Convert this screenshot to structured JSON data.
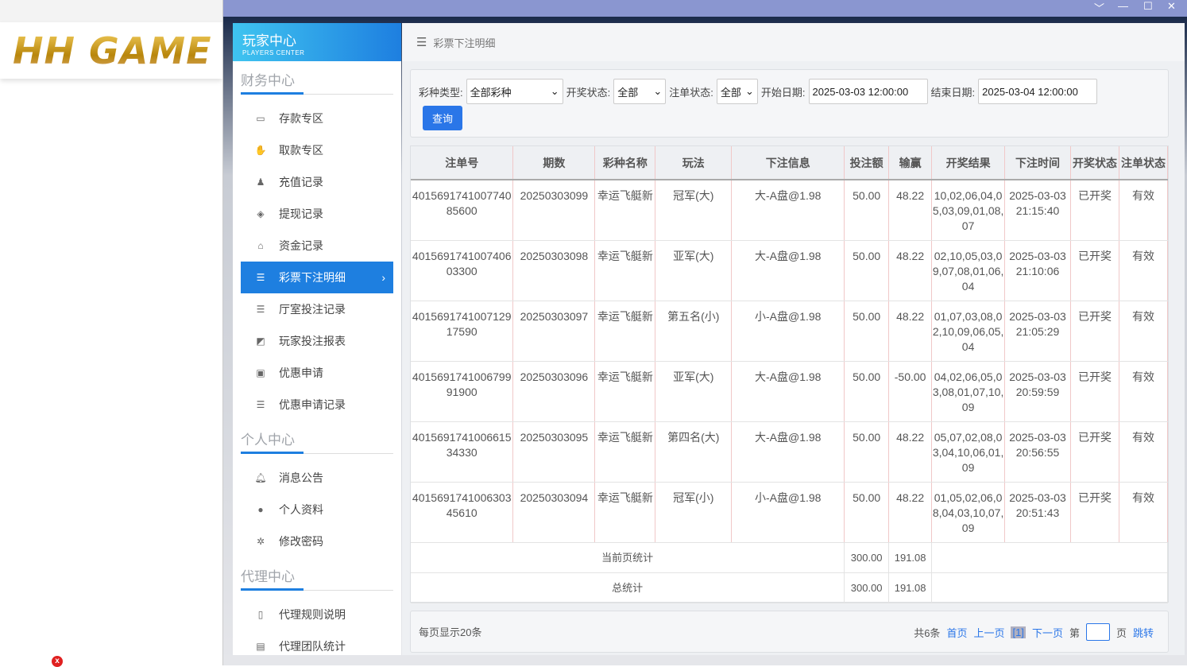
{
  "logo": {
    "text": "HH GAME"
  },
  "window": {
    "controls": [
      "chevron-down",
      "minimize",
      "maximize",
      "close"
    ]
  },
  "sidebar": {
    "title": "玩家中心",
    "subtitle": "PLAYERS CENTER",
    "sections": [
      {
        "title": "财务中心",
        "items": [
          {
            "label": "存款专区",
            "icon": "card-icon"
          },
          {
            "label": "取款专区",
            "icon": "hand-money-icon"
          },
          {
            "label": "充值记录",
            "icon": "money-bag-icon"
          },
          {
            "label": "提现记录",
            "icon": "wallet-icon"
          },
          {
            "label": "资金记录",
            "icon": "bank-icon"
          },
          {
            "label": "彩票下注明细",
            "icon": "list-icon",
            "active": true
          },
          {
            "label": "厅室投注记录",
            "icon": "list-icon"
          },
          {
            "label": "玩家投注报表",
            "icon": "chart-icon"
          },
          {
            "label": "优惠申请",
            "icon": "gift-icon"
          },
          {
            "label": "优惠申请记录",
            "icon": "list-icon"
          }
        ]
      },
      {
        "title": "个人中心",
        "items": [
          {
            "label": "消息公告",
            "icon": "bell-icon"
          },
          {
            "label": "个人资料",
            "icon": "user-icon"
          },
          {
            "label": "修改密码",
            "icon": "gear-icon"
          }
        ]
      },
      {
        "title": "代理中心",
        "items": [
          {
            "label": "代理规则说明",
            "icon": "document-icon"
          },
          {
            "label": "代理团队统计",
            "icon": "report-icon"
          }
        ]
      }
    ]
  },
  "breadcrumb": "彩票下注明细",
  "filter": {
    "type_label": "彩种类型:",
    "type_value": "全部彩种",
    "draw_label": "开奖状态:",
    "draw_value": "全部",
    "order_label": "注单状态:",
    "order_value": "全部",
    "start_label": "开始日期:",
    "start_value": "2025-03-03 12:00:00",
    "end_label": "结束日期:",
    "end_value": "2025-03-04 12:00:00",
    "query": "查询"
  },
  "table": {
    "headers": [
      "注单号",
      "期数",
      "彩种名称",
      "玩法",
      "下注信息",
      "投注额",
      "输赢",
      "开奖结果",
      "下注时间",
      "开奖状态",
      "注单状态"
    ],
    "rows": [
      [
        "401569174100774085600",
        "20250303099",
        "幸运飞艇新",
        "冠军(大)",
        "大-A盘@1.98",
        "50.00",
        "48.22",
        "10,02,06,04,05,03,09,01,08,07",
        "2025-03-03 21:15:40",
        "已开奖",
        "有效"
      ],
      [
        "401569174100740603300",
        "20250303098",
        "幸运飞艇新",
        "亚军(大)",
        "大-A盘@1.98",
        "50.00",
        "48.22",
        "02,10,05,03,09,07,08,01,06,04",
        "2025-03-03 21:10:06",
        "已开奖",
        "有效"
      ],
      [
        "401569174100712917590",
        "20250303097",
        "幸运飞艇新",
        "第五名(小)",
        "小-A盘@1.98",
        "50.00",
        "48.22",
        "01,07,03,08,02,10,09,06,05,04",
        "2025-03-03 21:05:29",
        "已开奖",
        "有效"
      ],
      [
        "401569174100679991900",
        "20250303096",
        "幸运飞艇新",
        "亚军(大)",
        "大-A盘@1.98",
        "50.00",
        "-50.00",
        "04,02,06,05,03,08,01,07,10,09",
        "2025-03-03 20:59:59",
        "已开奖",
        "有效"
      ],
      [
        "401569174100661534330",
        "20250303095",
        "幸运飞艇新",
        "第四名(大)",
        "大-A盘@1.98",
        "50.00",
        "48.22",
        "05,07,02,08,03,04,10,06,01,09",
        "2025-03-03 20:56:55",
        "已开奖",
        "有效"
      ],
      [
        "401569174100630345610",
        "20250303094",
        "幸运飞艇新",
        "冠军(小)",
        "小-A盘@1.98",
        "50.00",
        "48.22",
        "01,05,02,06,08,04,03,10,07,09",
        "2025-03-03 20:51:43",
        "已开奖",
        "有效"
      ]
    ],
    "page_sum": {
      "label": "当前页统计",
      "bet": "300.00",
      "win": "191.08"
    },
    "total_sum": {
      "label": "总统计",
      "bet": "300.00",
      "win": "191.08"
    }
  },
  "pager": {
    "per_page": "每页显示20条",
    "total": "共6条",
    "first": "首页",
    "prev": "上一页",
    "current": "[1]",
    "next": "下一页",
    "go_prefix": "第",
    "go_suffix": "页",
    "jump": "跳转"
  }
}
